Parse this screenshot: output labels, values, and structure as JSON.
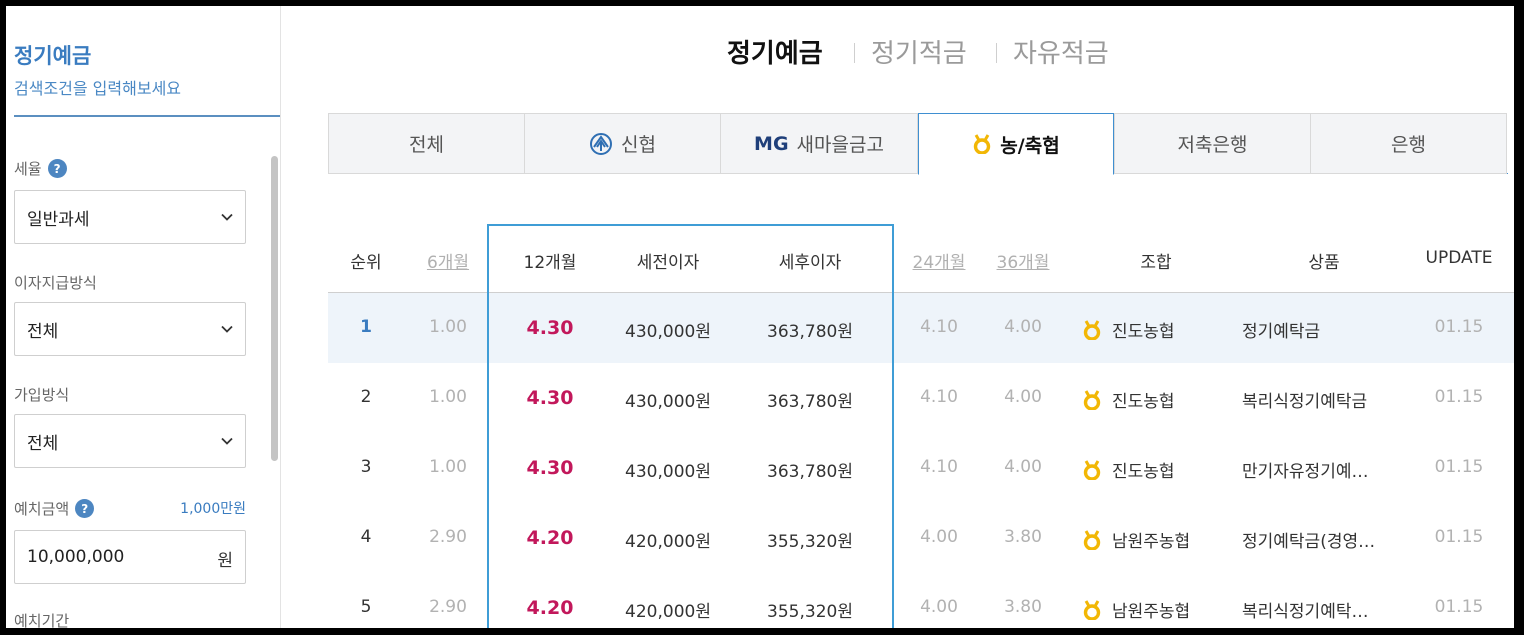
{
  "sidebar": {
    "title": "정기예금",
    "subtitle": "검색조건을 입력해보세요",
    "tax": {
      "label": "세율",
      "value": "일반과세"
    },
    "interest_payment": {
      "label": "이자지급방식",
      "value": "전체"
    },
    "join_method": {
      "label": "가입방식",
      "value": "전체"
    },
    "deposit_amount": {
      "label": "예치금액",
      "display": "1,000만원",
      "value": "10,000,000",
      "unit": "원"
    },
    "period_label": "예치기간",
    "help_glyph": "?"
  },
  "top_tabs": [
    {
      "label": "정기예금",
      "active": true
    },
    {
      "label": "정기적금",
      "active": false
    },
    {
      "label": "자유적금",
      "active": false
    }
  ],
  "bank_tabs": [
    {
      "label": "전체",
      "icon": ""
    },
    {
      "label": "신협",
      "icon": "shinhyup-logo-icon"
    },
    {
      "label": "새마을금고",
      "icon": "mg-logo-icon",
      "logo_text": "MG"
    },
    {
      "label": "농/축협",
      "icon": "nh-medal-icon",
      "active": true
    },
    {
      "label": "저축은행",
      "icon": ""
    },
    {
      "label": "은행",
      "icon": ""
    }
  ],
  "table": {
    "headers": {
      "rank": "순위",
      "m6": "6개월",
      "m12": "12개월",
      "pre_tax": "세전이자",
      "after_tax": "세후이자",
      "m24": "24개월",
      "m36": "36개월",
      "union": "조합",
      "product": "상품",
      "update": "UPDATE"
    },
    "rows": [
      {
        "rank": "1",
        "m6": "1.00",
        "m12": "4.30",
        "pre_tax": "430,000원",
        "after_tax": "363,780원",
        "m24": "4.10",
        "m36": "4.00",
        "union": "진도농협",
        "product": "정기예탁금",
        "update": "01.15"
      },
      {
        "rank": "2",
        "m6": "1.00",
        "m12": "4.30",
        "pre_tax": "430,000원",
        "after_tax": "363,780원",
        "m24": "4.10",
        "m36": "4.00",
        "union": "진도농협",
        "product": "복리식정기예탁금",
        "update": "01.15"
      },
      {
        "rank": "3",
        "m6": "1.00",
        "m12": "4.30",
        "pre_tax": "430,000원",
        "after_tax": "363,780원",
        "m24": "4.10",
        "m36": "4.00",
        "union": "진도농협",
        "product": "만기자유정기예…",
        "update": "01.15"
      },
      {
        "rank": "4",
        "m6": "2.90",
        "m12": "4.20",
        "pre_tax": "420,000원",
        "after_tax": "355,320원",
        "m24": "4.00",
        "m36": "3.80",
        "union": "남원주농협",
        "product": "정기예탁금(경영…",
        "update": "01.15"
      },
      {
        "rank": "5",
        "m6": "2.90",
        "m12": "4.20",
        "pre_tax": "420,000원",
        "after_tax": "355,320원",
        "m24": "4.00",
        "m36": "3.80",
        "union": "남원주농협",
        "product": "복리식정기예탁…",
        "update": "01.15"
      }
    ]
  },
  "colors": {
    "accent": "#3f8fd1",
    "rate": "#c2185b",
    "medal": "#f2b705"
  }
}
